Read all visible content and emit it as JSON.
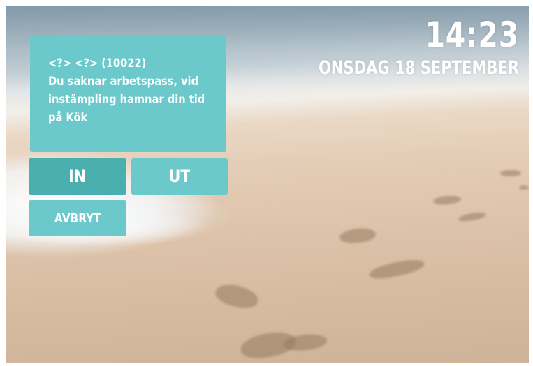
{
  "clock": {
    "time": "14:23",
    "date": "ONSDAG 18 SEPTEMBER"
  },
  "message": {
    "lines": [
      "<?> <?> (10022)",
      "Du saknar arbetspass, vid",
      "instämpling hamnar din tid",
      "på Kök"
    ]
  },
  "buttons": {
    "in_label": "IN",
    "out_label": "UT",
    "cancel_label": "AVBRYT"
  },
  "colors": {
    "panel": "#6cc9cb",
    "button_active": "#4aafaf",
    "button": "#6cc9cb",
    "text": "#ffffff"
  }
}
